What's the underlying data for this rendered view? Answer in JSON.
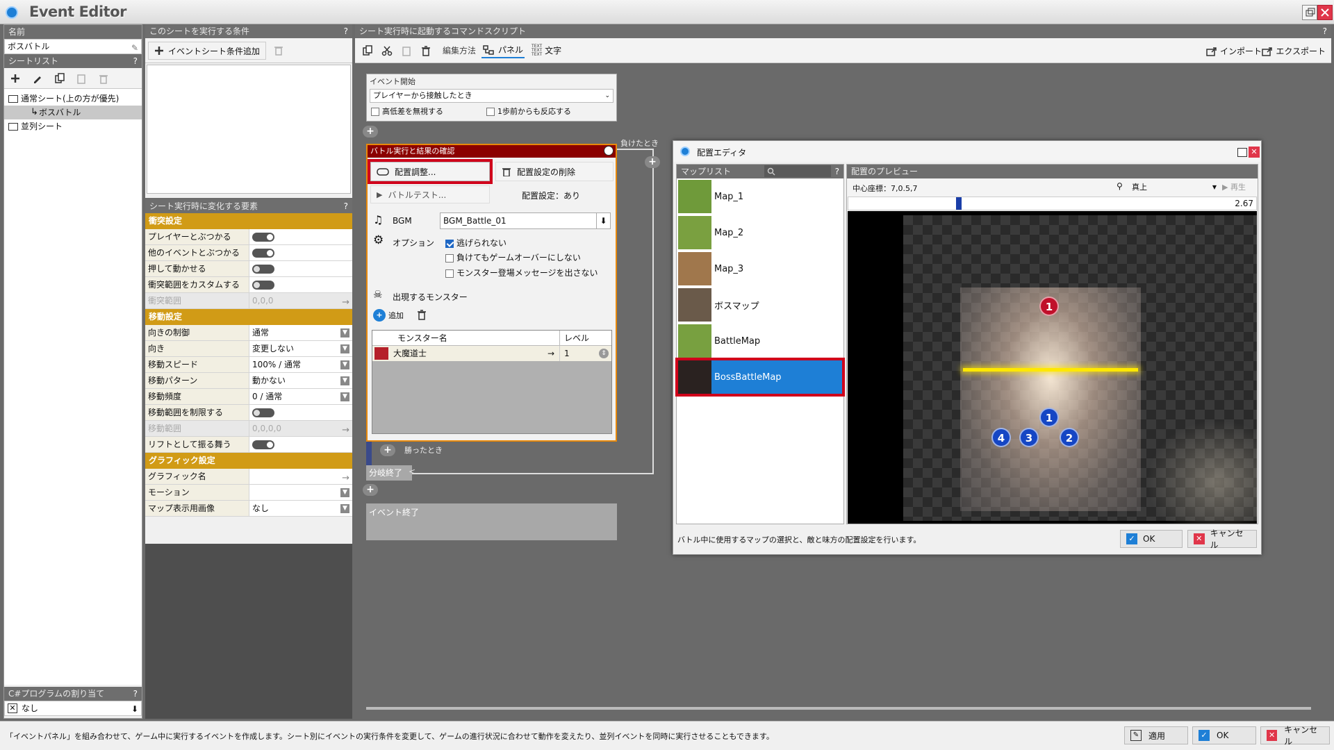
{
  "window": {
    "title": "Event Editor"
  },
  "left": {
    "name_header": "名前",
    "name_value": "ボスバトル",
    "sheet_list_header": "シートリスト",
    "tree": [
      {
        "label": "通常シート(上の方が優先)"
      },
      {
        "label": "ボスバトル"
      },
      {
        "label": "並列シート"
      }
    ],
    "csharp_header": "C#プログラムの割り当て",
    "csharp_value": "なし"
  },
  "conditions": {
    "header": "このシートを実行する条件",
    "add_label": "イベントシート条件追加"
  },
  "props": {
    "header": "シート実行時に変化する要素",
    "sections": [
      {
        "title": "衝突設定",
        "rows": [
          {
            "k": "プレイヤーとぶつかる",
            "v": "",
            "ctrl": "toggle-on"
          },
          {
            "k": "他のイベントとぶつかる",
            "v": "",
            "ctrl": "toggle-on"
          },
          {
            "k": "押して動かせる",
            "v": "",
            "ctrl": "toggle-off"
          },
          {
            "k": "衝突範囲をカスタムする",
            "v": "",
            "ctrl": "toggle-off"
          },
          {
            "k": "衝突範囲",
            "v": "0,0,0",
            "ctrl": "arrow",
            "disabled": true
          }
        ]
      },
      {
        "title": "移動設定",
        "rows": [
          {
            "k": "向きの制御",
            "v": "通常",
            "ctrl": "dd"
          },
          {
            "k": "向き",
            "v": "変更しない",
            "ctrl": "dd"
          },
          {
            "k": "移動スピード",
            "v": "100% / 通常",
            "ctrl": "dd"
          },
          {
            "k": "移動パターン",
            "v": "動かない",
            "ctrl": "dd"
          },
          {
            "k": "移動頻度",
            "v": "0 / 通常",
            "ctrl": "dd"
          },
          {
            "k": "移動範囲を制限する",
            "v": "",
            "ctrl": "toggle-off"
          },
          {
            "k": "移動範囲",
            "v": "0,0,0,0",
            "ctrl": "arrow",
            "disabled": true
          },
          {
            "k": "リフトとして振る舞う",
            "v": "",
            "ctrl": "toggle-on"
          }
        ]
      },
      {
        "title": "グラフィック設定",
        "rows": [
          {
            "k": "グラフィック名",
            "v": "",
            "ctrl": "arrow"
          },
          {
            "k": "モーション",
            "v": "",
            "ctrl": "dd"
          },
          {
            "k": "マップ表示用画像",
            "v": "なし",
            "ctrl": "dd"
          }
        ]
      }
    ]
  },
  "script": {
    "header": "シート実行時に起動するコマンドスクリプト",
    "edit_method": "編集方法",
    "panel_label": "パネル",
    "text_label": "文字",
    "import_label": "インポート",
    "export_label": "エクスポート",
    "event_start": {
      "title": "イベント開始",
      "trigger": "プレイヤーから接触したとき",
      "opt1": "高低差を無視する",
      "opt2": "1歩前からも反応する"
    },
    "lose_label": "負けたとき",
    "win_label": "勝ったとき",
    "branch_end": "分岐終了",
    "event_end": "イベント終了",
    "battle": {
      "title": "バトル実行と結果の確認",
      "layout_btn": "配置調整...",
      "delete_layout_btn": "配置設定の削除",
      "test_btn": "バトルテスト...",
      "layout_status": "配置設定：あり",
      "bgm_label": "BGM",
      "bgm_value": "BGM_Battle_01",
      "options_label": "オプション",
      "options": [
        {
          "label": "逃げられない",
          "checked": true
        },
        {
          "label": "負けてもゲームオーバーにしない",
          "checked": false
        },
        {
          "label": "モンスター登場メッセージを出さない",
          "checked": false
        }
      ],
      "monsters_label": "出現するモンスター",
      "add_label": "追加",
      "col_name": "モンスター名",
      "col_level": "レベル",
      "monsters": [
        {
          "name": "大魔道士",
          "level": "1"
        }
      ]
    }
  },
  "dialog": {
    "title": "配置エディタ",
    "maplist_header": "マップリスト",
    "preview_header": "配置のプレビュー",
    "center_coord": "中心座標：7,0.5,7",
    "view": "真上",
    "play": "再生",
    "zoom": "2.67",
    "maps": [
      {
        "name": "Map_1",
        "color": "#6f9a3a"
      },
      {
        "name": "Map_2",
        "color": "#7aa040"
      },
      {
        "name": "Map_3",
        "color": "#a0774c"
      },
      {
        "name": "ボスマップ",
        "color": "#6a5a4a"
      },
      {
        "name": "BattleMap",
        "color": "#78a040"
      },
      {
        "name": "BossBattleMap",
        "color": "#2a2220",
        "selected": true
      }
    ],
    "enemies": [
      "1"
    ],
    "allies": [
      "1",
      "4",
      "3",
      "2"
    ],
    "hint": "バトル中に使用するマップの選択と、敵と味方の配置設定を行います。",
    "ok": "OK",
    "cancel": "キャンセル"
  },
  "statusbar": {
    "text": "「イベントパネル」を組み合わせて、ゲーム中に実行するイベントを作成します。シート別にイベントの実行条件を変更して、ゲームの進行状況に合わせて動作を変えたり、並列イベントを同時に実行させることもできます。",
    "apply": "適用",
    "ok": "OK",
    "cancel": "キャンセル"
  },
  "colors": {
    "accent": "#1e7fd6",
    "highlight": "#d0021b",
    "section": "#d19b16",
    "battle_header": "#8b0000"
  }
}
